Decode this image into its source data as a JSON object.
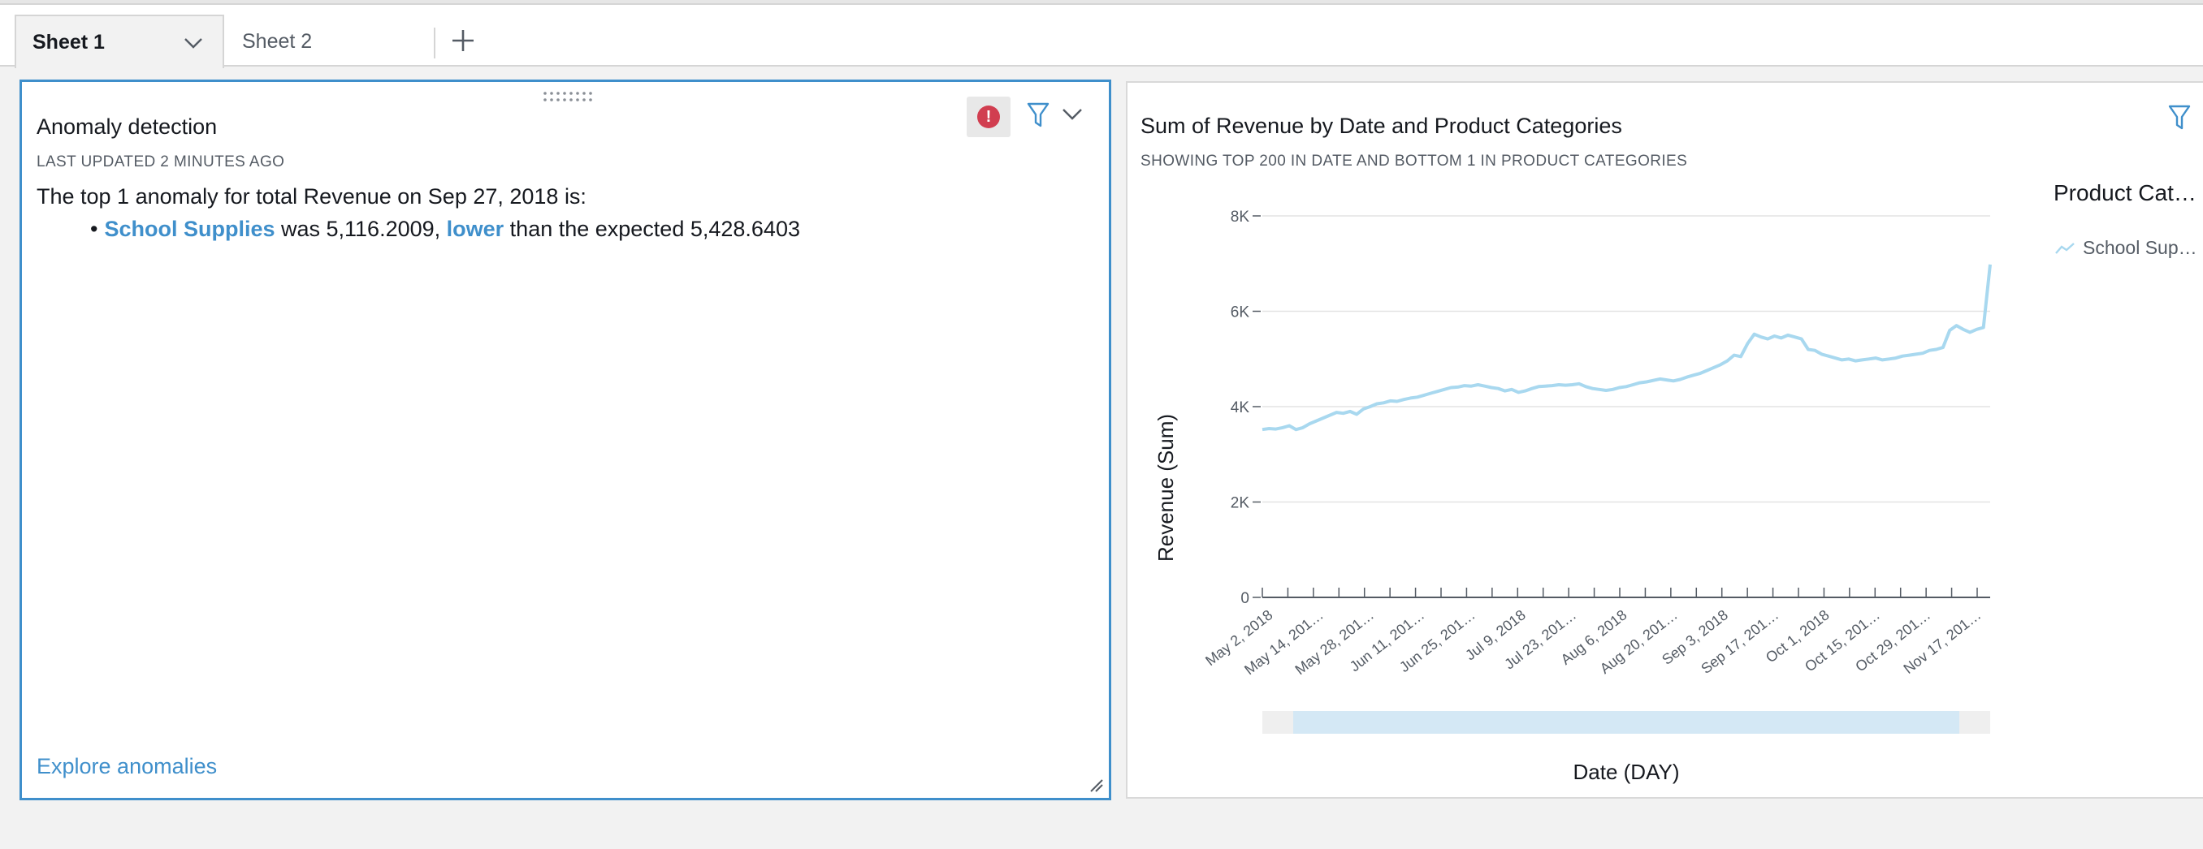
{
  "tabs": {
    "sheet1_label": "Sheet 1",
    "sheet2_label": "Sheet 2"
  },
  "anomaly_panel": {
    "title": "Anomaly detection",
    "updated": "LAST UPDATED 2 MINUTES AGO",
    "intro": "The top 1 anomaly for total Revenue on Sep 27, 2018 is:",
    "bullet": "•",
    "category": "School Supplies",
    "text_was": " was 5,116.2009, ",
    "direction": "lower",
    "text_expected": " than the expected 5,428.6403",
    "explore_label": "Explore anomalies"
  },
  "chart_panel": {
    "title": "Sum of Revenue by Date and Product Categories",
    "subtitle": "SHOWING TOP 200 IN DATE AND BOTTOM 1 IN PRODUCT CATEGORIES",
    "legend_title": "Product Cat…",
    "legend_item": "School Sup…"
  },
  "colors": {
    "accent": "#3f8fcb",
    "alert": "#d13e50",
    "series": "#a8d8ef"
  },
  "chart_data": {
    "type": "line",
    "xlabel": "Date (DAY)",
    "ylabel": "Revenue (Sum)",
    "yticks": [
      "0",
      "2K",
      "4K",
      "6K",
      "8K"
    ],
    "ylim": [
      0,
      8000
    ],
    "x_tick_labels": [
      "May 2, 2018",
      "May 14, 201…",
      "May 28, 201…",
      "Jun 11, 201…",
      "Jun 25, 201…",
      "Jul 9, 2018",
      "Jul 23, 201…",
      "Aug 6, 2018",
      "Aug 20, 201…",
      "Sep 3, 2018",
      "Sep 17, 201…",
      "Oct 1, 2018",
      "Oct 15, 201…",
      "Oct 29, 201…",
      "Nov 17, 201…"
    ],
    "legend_position": "right",
    "grid": true,
    "series": [
      {
        "name": "School Sup…",
        "x_range": [
          "May 2, 2018",
          "Nov 17, 2018"
        ],
        "values": [
          3520,
          3540,
          3530,
          3560,
          3600,
          3520,
          3560,
          3640,
          3700,
          3760,
          3820,
          3880,
          3860,
          3900,
          3840,
          3950,
          4000,
          4060,
          4080,
          4120,
          4110,
          4150,
          4180,
          4200,
          4240,
          4280,
          4320,
          4360,
          4400,
          4410,
          4440,
          4430,
          4460,
          4430,
          4400,
          4380,
          4330,
          4360,
          4300,
          4330,
          4380,
          4420,
          4430,
          4440,
          4460,
          4450,
          4460,
          4480,
          4420,
          4380,
          4360,
          4340,
          4360,
          4400,
          4420,
          4460,
          4500,
          4520,
          4550,
          4580,
          4560,
          4540,
          4570,
          4620,
          4660,
          4700,
          4760,
          4820,
          4880,
          4960,
          5080,
          5050,
          5320,
          5520,
          5460,
          5420,
          5480,
          5440,
          5500,
          5460,
          5420,
          5200,
          5180,
          5100,
          5060,
          5020,
          4980,
          5000,
          4960,
          4980,
          5000,
          5020,
          4980,
          5000,
          5020,
          5060,
          5080,
          5100,
          5120,
          5180,
          5200,
          5240,
          5600,
          5700,
          5620,
          5560,
          5620,
          5660,
          6980
        ]
      }
    ]
  }
}
